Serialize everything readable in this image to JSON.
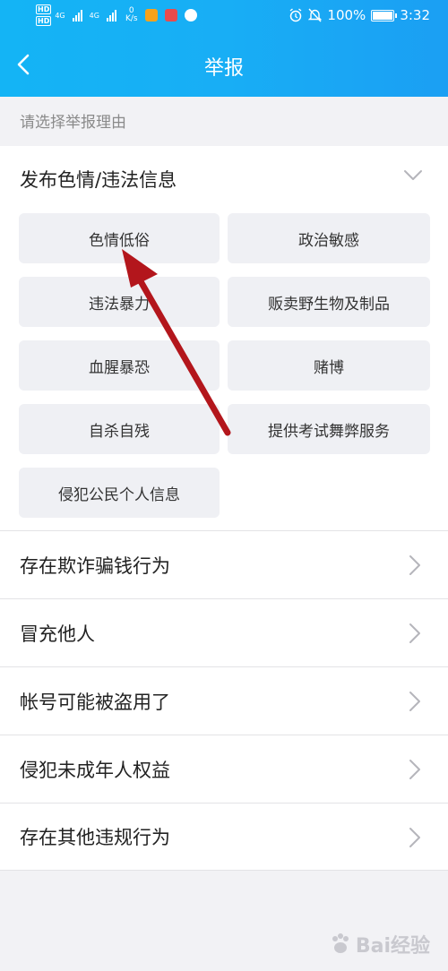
{
  "status_bar": {
    "hd_labels": [
      "HD",
      "HD"
    ],
    "net_labels": [
      "4G",
      "4G"
    ],
    "speed_value": "0",
    "speed_unit": "K/s",
    "battery": "100%",
    "time": "3:32"
  },
  "header": {
    "title": "举报",
    "back_icon": "chevron-left-icon"
  },
  "hint": "请选择举报理由",
  "expanded_category": {
    "label": "发布色情/违法信息",
    "options": [
      "色情低俗",
      "政治敏感",
      "违法暴力",
      "贩卖野生物及制品",
      "血腥暴恐",
      "赌博",
      "自杀自残",
      "提供考试舞弊服务",
      "侵犯公民个人信息"
    ]
  },
  "categories": [
    {
      "label": "存在欺诈骗钱行为"
    },
    {
      "label": "冒充他人"
    },
    {
      "label": "帐号可能被盗用了"
    },
    {
      "label": "侵犯未成年人权益"
    },
    {
      "label": "存在其他违规行为"
    }
  ],
  "watermark": "Bai经验",
  "colors": {
    "header_start": "#14b4f5",
    "header_end": "#1b9ff3",
    "annotation_arrow": "#b3161c",
    "chip_bg": "#eff0f4"
  }
}
